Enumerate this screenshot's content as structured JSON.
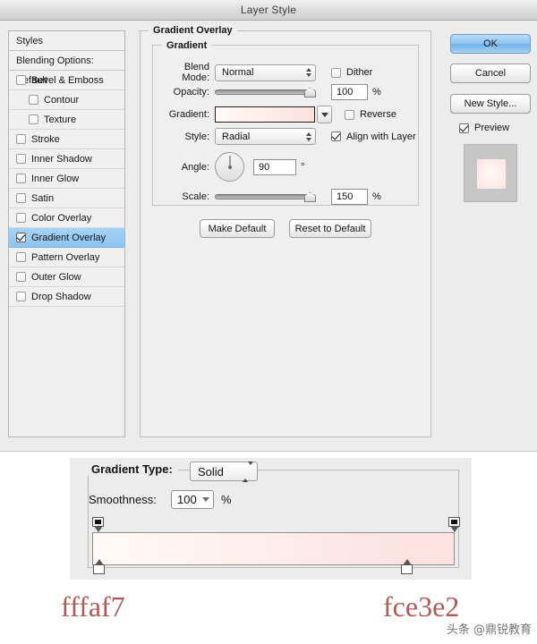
{
  "window": {
    "title": "Layer Style"
  },
  "colors": {
    "selection_blue": "#8cc4f0",
    "gradient_start": "#fffaf7",
    "gradient_end": "#fce3e2",
    "hex_text": "#b05a5a",
    "dialog_bg": "#ececec",
    "panel_bg": "#efefef"
  },
  "styles_panel": {
    "header": "Styles",
    "blending_options": "Blending Options: Default",
    "items": [
      {
        "label": "Bevel & Emboss",
        "checked": false,
        "indent": false,
        "selected": false
      },
      {
        "label": "Contour",
        "checked": false,
        "indent": true,
        "selected": false
      },
      {
        "label": "Texture",
        "checked": false,
        "indent": true,
        "selected": false
      },
      {
        "label": "Stroke",
        "checked": false,
        "indent": false,
        "selected": false
      },
      {
        "label": "Inner Shadow",
        "checked": false,
        "indent": false,
        "selected": false
      },
      {
        "label": "Inner Glow",
        "checked": false,
        "indent": false,
        "selected": false
      },
      {
        "label": "Satin",
        "checked": false,
        "indent": false,
        "selected": false
      },
      {
        "label": "Color Overlay",
        "checked": false,
        "indent": false,
        "selected": false
      },
      {
        "label": "Gradient Overlay",
        "checked": true,
        "indent": false,
        "selected": true
      },
      {
        "label": "Pattern Overlay",
        "checked": false,
        "indent": false,
        "selected": false
      },
      {
        "label": "Outer Glow",
        "checked": false,
        "indent": false,
        "selected": false
      },
      {
        "label": "Drop Shadow",
        "checked": false,
        "indent": false,
        "selected": false
      }
    ]
  },
  "gradient_overlay": {
    "section_title": "Gradient Overlay",
    "group_title": "Gradient",
    "blend_mode": {
      "label": "Blend Mode:",
      "value": "Normal"
    },
    "dither": {
      "label": "Dither",
      "checked": false
    },
    "opacity": {
      "label": "Opacity:",
      "value": "100",
      "unit": "%"
    },
    "gradient": {
      "label": "Gradient:"
    },
    "reverse": {
      "label": "Reverse",
      "checked": false
    },
    "style": {
      "label": "Style:",
      "value": "Radial"
    },
    "align_with_layer": {
      "label": "Align with Layer",
      "checked": true
    },
    "angle": {
      "label": "Angle:",
      "value": "90",
      "unit": "°"
    },
    "scale": {
      "label": "Scale:",
      "value": "150",
      "unit": "%"
    },
    "make_default": "Make Default",
    "reset_to_default": "Reset to Default"
  },
  "actions": {
    "ok": "OK",
    "cancel": "Cancel",
    "new_style": "New Style...",
    "preview": {
      "label": "Preview",
      "checked": true
    }
  },
  "gradient_editor": {
    "gradient_type": {
      "label": "Gradient Type:",
      "value": "Solid"
    },
    "smoothness": {
      "label": "Smoothness:",
      "value": "100",
      "unit": "%"
    },
    "opacity_stops": [
      {
        "position_pct": 0
      },
      {
        "position_pct": 100
      }
    ],
    "color_stops": [
      {
        "position_pct": 1,
        "color": "#fffaf7"
      },
      {
        "position_pct": 86,
        "color": "#fce3e2"
      }
    ]
  },
  "hex_labels": {
    "left": "fffaf7",
    "right": "fce3e2"
  },
  "watermark": "头条 @鼎锐教育"
}
